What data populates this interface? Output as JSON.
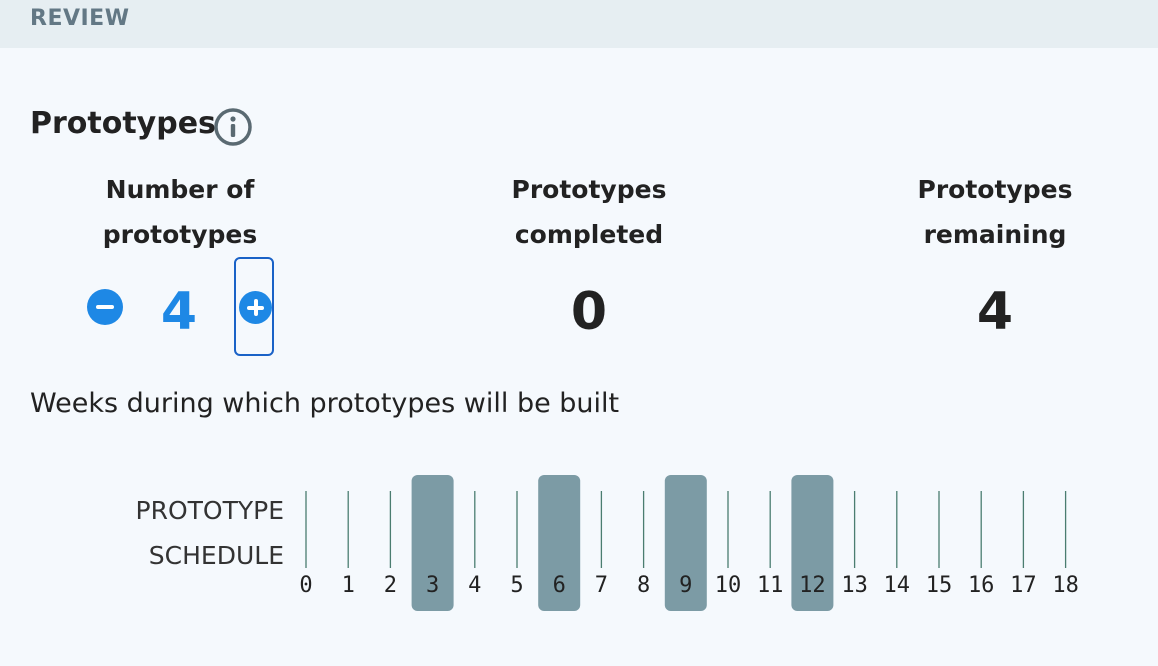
{
  "header": {
    "title": "REVIEW"
  },
  "prototypes": {
    "title": "Prototypes",
    "info_icon": "info-circle-icon",
    "columns": [
      {
        "label_line1": "Number of",
        "label_line2": "prototypes",
        "value": "4"
      },
      {
        "label_line1": "Prototypes",
        "label_line2": "completed",
        "value": "0"
      },
      {
        "label_line1": "Prototypes",
        "label_line2": "remaining",
        "value": "4"
      }
    ],
    "decrement_icon": "minus-circle-icon",
    "increment_icon": "plus-circle-icon"
  },
  "schedule": {
    "caption": "Weeks during which prototypes will be built",
    "label_line1": "PROTOTYPE",
    "label_line2": "SCHEDULE",
    "weeks": [
      "0",
      "1",
      "2",
      "3",
      "4",
      "5",
      "6",
      "7",
      "8",
      "9",
      "10",
      "11",
      "12",
      "13",
      "14",
      "15",
      "16",
      "17",
      "18"
    ],
    "highlighted_weeks": [
      "3",
      "6",
      "9",
      "12"
    ]
  },
  "colors": {
    "accent": "#1e88e5",
    "focus": "#1a62c7",
    "highlight": "#7c9ba5",
    "tick": "#4b7d70",
    "header_bg": "#e6eef2",
    "page_bg": "#f5f9fd"
  }
}
